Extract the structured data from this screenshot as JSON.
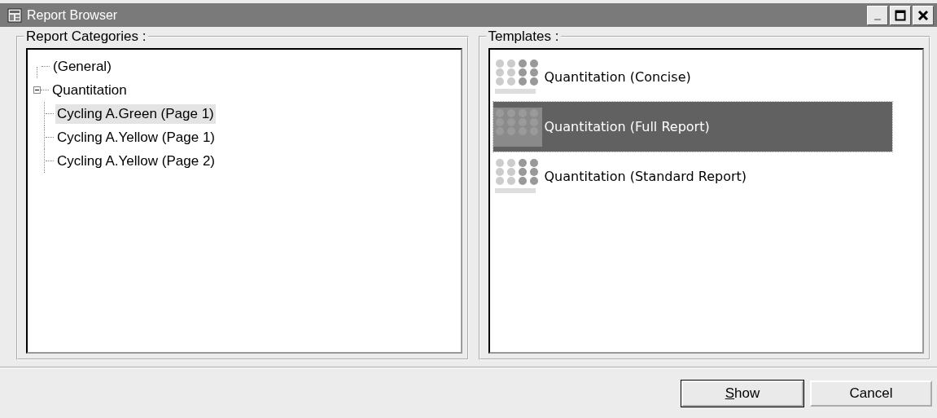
{
  "window": {
    "title": "Report Browser"
  },
  "categories": {
    "label": "Report Categories :",
    "tree": [
      {
        "label": "(General)",
        "selected": false
      },
      {
        "label": "Quantitation",
        "selected": false,
        "expanded": true,
        "children": [
          {
            "label": "Cycling A.Green (Page 1)",
            "selected": true
          },
          {
            "label": "Cycling A.Yellow (Page 1)",
            "selected": false
          },
          {
            "label": "Cycling A.Yellow (Page 2)",
            "selected": false
          }
        ]
      }
    ]
  },
  "templates": {
    "label": "Templates :",
    "items": [
      {
        "label": "Quantitation (Concise)",
        "selected": false
      },
      {
        "label": "Quantitation (Full Report)",
        "selected": true
      },
      {
        "label": "Quantitation (Standard Report)",
        "selected": false
      }
    ]
  },
  "buttons": [
    {
      "label": "Show",
      "default": true
    },
    {
      "label": "Cancel",
      "default": false
    }
  ]
}
